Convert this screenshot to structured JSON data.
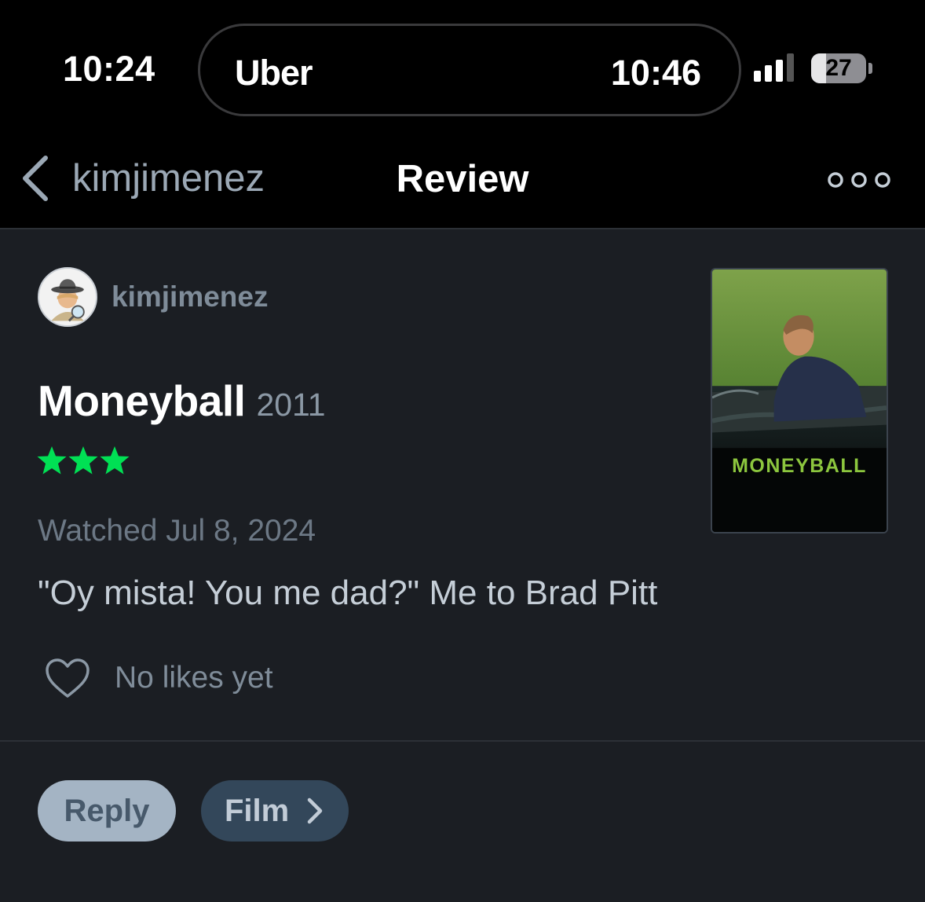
{
  "status_bar": {
    "time": "10:24",
    "live_activity": {
      "app": "Uber",
      "eta": "10:46"
    },
    "signal_bars": 3,
    "battery_percent": "27"
  },
  "nav": {
    "back_label": "kimjimenez",
    "title": "Review",
    "back_icon": "chevron-left-icon",
    "more_icon": "more-options-icon"
  },
  "review": {
    "author": "kimjimenez",
    "avatar_icon": "detective-emoji-avatar",
    "film_title": "Moneyball",
    "film_year": "2011",
    "rating_stars": 3,
    "watched": "Watched Jul 8, 2024",
    "text": "\"Oy mista! You me dad?\" Me to Brad Pitt",
    "likes_label": "No likes yet",
    "likes_icon": "heart-outline-icon",
    "poster_title": "MONEYBALL"
  },
  "actions": {
    "reply_label": "Reply",
    "film_label": "Film",
    "film_icon": "chevron-right-icon"
  },
  "colors": {
    "background": "#1b1e23",
    "star_green": "#00e054",
    "title_white": "#ffffff",
    "muted_text": "#6c7885"
  }
}
